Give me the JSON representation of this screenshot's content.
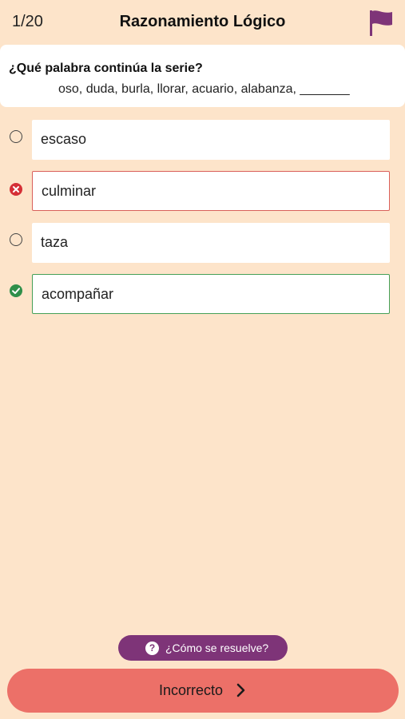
{
  "header": {
    "counter": "1/20",
    "title": "Razonamiento Lógico",
    "flag_icon": "flag-icon"
  },
  "question": {
    "prompt": "¿Qué palabra continúa la serie?",
    "series": "oso, duda, burla, llorar, acuario, alabanza, _______"
  },
  "options": [
    {
      "label": "escaso",
      "state": "unselected"
    },
    {
      "label": "culminar",
      "state": "incorrect"
    },
    {
      "label": "taza",
      "state": "unselected"
    },
    {
      "label": "acompañar",
      "state": "correct"
    }
  ],
  "help": {
    "label": "¿Cómo se resuelve?",
    "icon": "question-icon"
  },
  "result": {
    "label": "Incorrecto",
    "icon": "chevron-right-icon"
  },
  "colors": {
    "background": "#FDE4CA",
    "accent_purple": "#7E3478",
    "incorrect": "#D52F36",
    "correct": "#2F8F4A",
    "result_button": "#EC7068"
  }
}
